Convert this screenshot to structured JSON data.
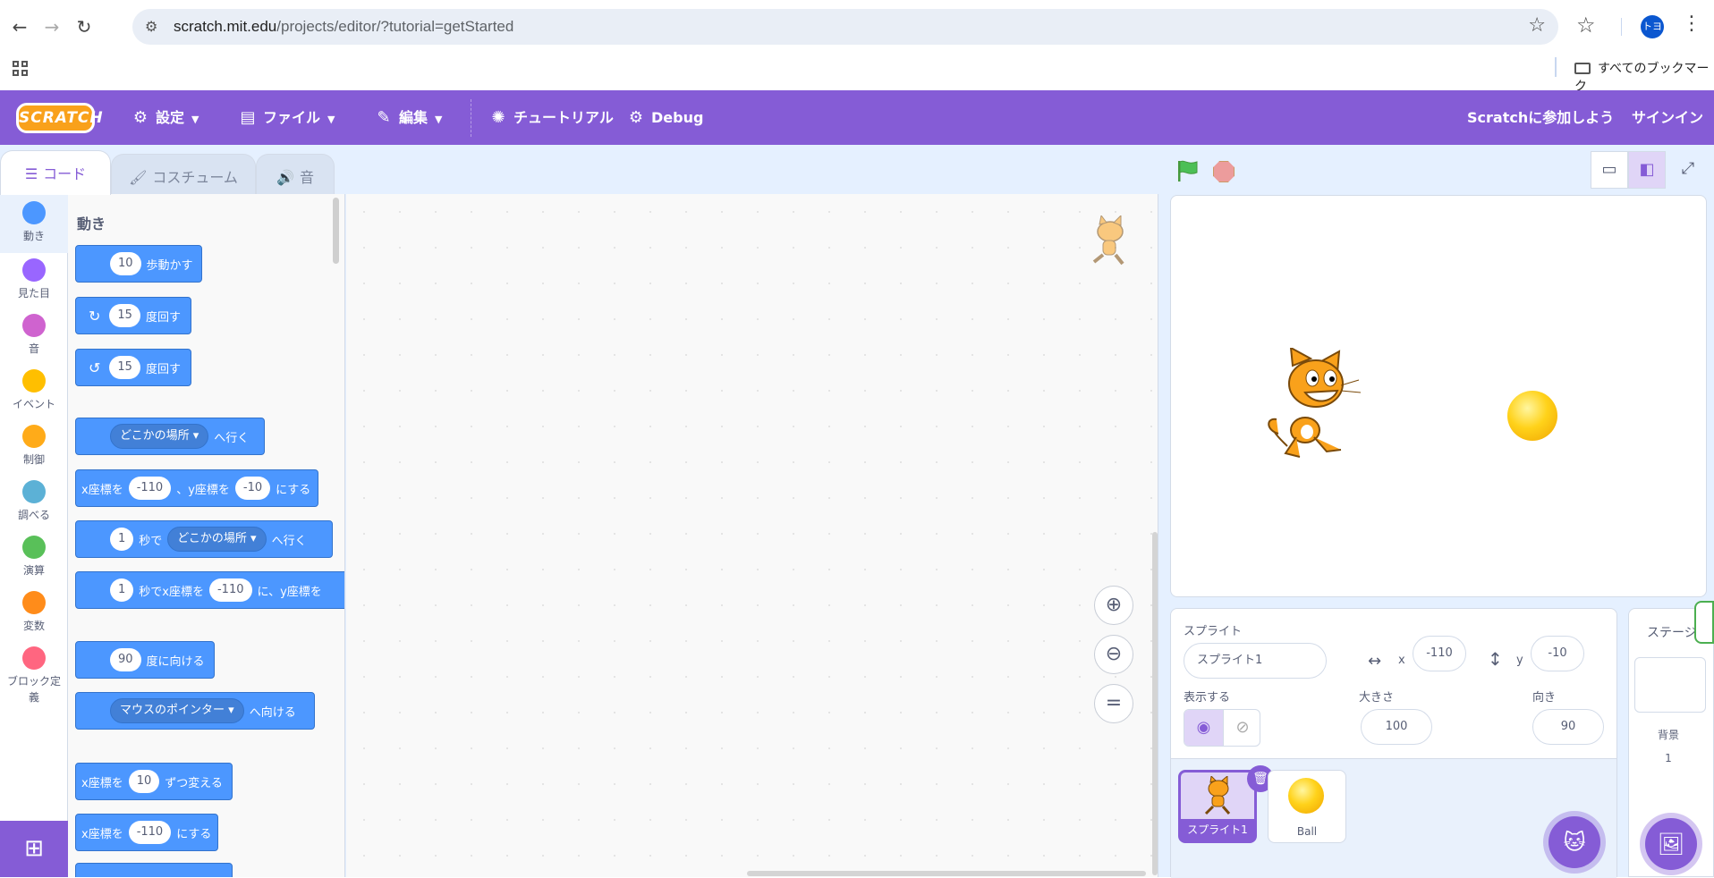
{
  "browser": {
    "url_host": "scratch.mit.edu",
    "url_path": "/projects/editor/?tutorial=getStarted",
    "avatar_text": "トヨ",
    "bookmarks_label": "すべてのブックマーク"
  },
  "menubar": {
    "logo": "SCRATCH",
    "settings": "設定",
    "file": "ファイル",
    "edit": "編集",
    "tutorials": "チュートリアル",
    "debug": "Debug",
    "join": "Scratchに参加しよう",
    "signin": "サインイン"
  },
  "tabs": {
    "code": "コード",
    "costumes": "コスチューム",
    "sounds": "音"
  },
  "categories": [
    {
      "label": "動き",
      "color": "#4c97ff"
    },
    {
      "label": "見た目",
      "color": "#9966ff"
    },
    {
      "label": "音",
      "color": "#cf63cf"
    },
    {
      "label": "イベント",
      "color": "#ffbf00"
    },
    {
      "label": "制御",
      "color": "#ffab19"
    },
    {
      "label": "調べる",
      "color": "#5cb1d6"
    },
    {
      "label": "演算",
      "color": "#59c059"
    },
    {
      "label": "変数",
      "color": "#ff8c1a"
    },
    {
      "label": "ブロック定義",
      "color": "#ff6680"
    }
  ],
  "palette": {
    "title": "動き",
    "move": {
      "val": "10",
      "text": "歩動かす"
    },
    "turn_right": {
      "val": "15",
      "text": "度回す"
    },
    "turn_left": {
      "val": "15",
      "text": "度回す"
    },
    "goto": {
      "menu": "どこかの場所",
      "text": "へ行く"
    },
    "gotoxy": {
      "a": "x座標を",
      "x": "-110",
      "b": "、y座標を",
      "y": "-10",
      "c": "にする"
    },
    "glide": {
      "secs": "1",
      "a": "秒で",
      "menu": "どこかの場所",
      "b": "へ行く"
    },
    "glidexy": {
      "secs": "1",
      "a": "秒でx座標を",
      "x": "-110",
      "b": "に、y座標を"
    },
    "point_dir": {
      "val": "90",
      "text": "度に向ける"
    },
    "point_towards": {
      "menu": "マウスのポインター",
      "text": "へ向ける"
    },
    "change_x": {
      "a": "x座標を",
      "val": "10",
      "b": "ずつ変える"
    },
    "set_x": {
      "a": "x座標を",
      "val": "-110",
      "b": "にする"
    }
  },
  "sprite_info": {
    "sprite_label": "スプライト",
    "name": "スプライト1",
    "x_label": "x",
    "x": "-110",
    "y_label": "y",
    "y": "-10",
    "show_label": "表示する",
    "size_label": "大きさ",
    "size": "100",
    "direction_label": "向き",
    "direction": "90"
  },
  "sprites": [
    {
      "name": "スプライト1",
      "selected": true
    },
    {
      "name": "Ball",
      "selected": false
    }
  ],
  "stage_panel": {
    "title": "ステージ",
    "backdrop_label": "背景",
    "backdrop_count": "1"
  },
  "colors": {
    "scratch_purple": "#855cd6",
    "motion_blue": "#4c97ff"
  }
}
